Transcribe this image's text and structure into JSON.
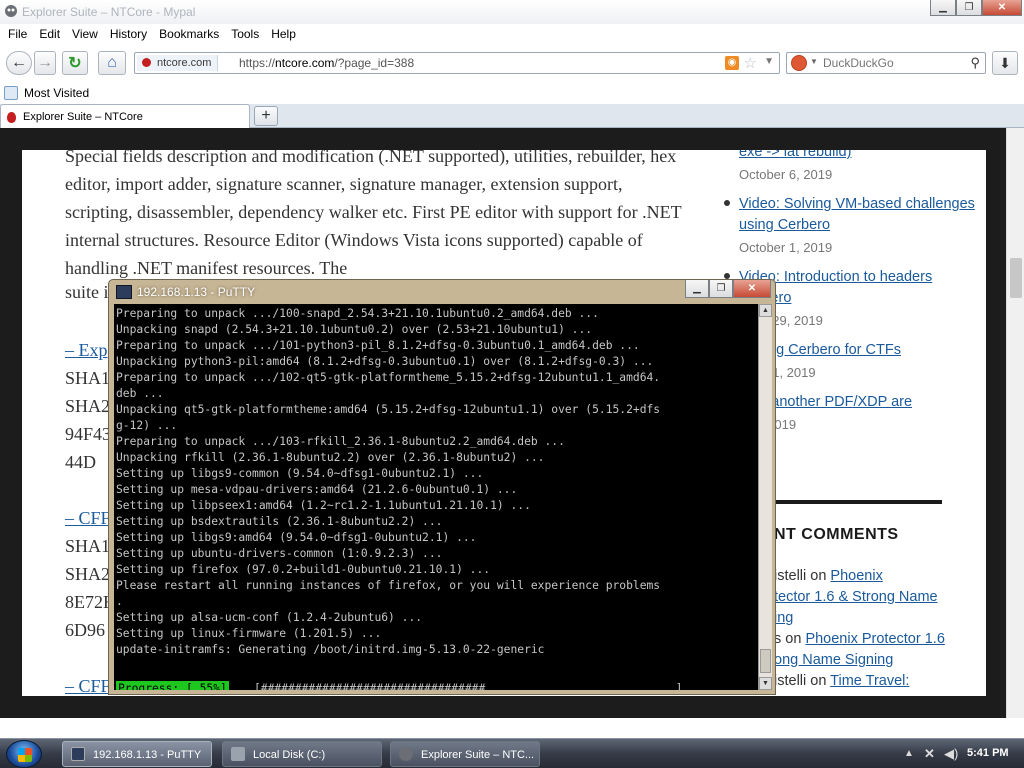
{
  "browser": {
    "title": "Explorer Suite – NTCore - Mypal",
    "menu": [
      "File",
      "Edit",
      "View",
      "History",
      "Bookmarks",
      "Tools",
      "Help"
    ],
    "site_chip": "ntcore.com",
    "url_prefix": "https://",
    "url_host": "ntcore.com",
    "url_path": "/?page_id=388",
    "search_engine": "DuckDuckGo",
    "search_placeholder": "DuckDuckGo",
    "bookmark": "Most Visited",
    "tab_title": "Explorer Suite – NTCore",
    "new_tab": "+"
  },
  "article": {
    "text": "Special fields description and modification (.NET supported), utilities, rebuilder, hex editor, import adder, signature scanner, signature manager, extension support, scripting, disassembler, dependency walker etc. First PE editor with support for .NET internal structures. Resource Editor (Windows Vista icons supported) capable of handling .NET manifest resources. The",
    "suite": "suite i",
    "exp_link": "– Exp",
    "sha1_a": "SHA1:",
    "sha2_a": "SHA2",
    "hash_a": "94F43",
    "hash_b": "44D",
    "cff_link_a": "– CFF",
    "sha1_b": "SHA1:",
    "sha2_b": "SHA2",
    "hash_c": "8E72E",
    "hash_d": "6D96",
    "cff_link_b": "– CFF"
  },
  "sidebar": {
    "posts": [
      {
        "title": "exe -> lat rebuild)",
        "date": "October 6, 2019"
      },
      {
        "title": "Video: Solving VM-based challenges using Cerbero",
        "date": "October 1, 2019"
      },
      {
        "title": "Video: Introduction to headers Cerbero",
        "date": "mber 29, 2019"
      },
      {
        "title": ": Using Cerbero for CTFs",
        "date": "mber 1, 2019"
      },
      {
        "title": ": Yet another PDF/XDP are",
        "date": "st 5, 2019"
      }
    ],
    "recent_heading": "NT COMMENTS",
    "comments": [
      {
        "author": "istelli",
        "on": " on ",
        "link": "Phoenix"
      },
      {
        "author": "",
        "on": "",
        "link": "tector 1.6 & Strong Name"
      },
      {
        "author": "",
        "on": "",
        "link": "ing"
      },
      {
        "author": "s",
        "on": " on ",
        "link": "Phoenix Protector 1.6"
      },
      {
        "author": "",
        "on": "",
        "link": "ong Name Signing"
      },
      {
        "author": "istelli",
        "on": " on ",
        "link": "Time Travel:"
      }
    ]
  },
  "putty": {
    "title": "192.168.1.13 - PuTTY",
    "lines": [
      "Preparing to unpack .../100-snapd_2.54.3+21.10.1ubuntu0.2_amd64.deb ...",
      "Unpacking snapd (2.54.3+21.10.1ubuntu0.2) over (2.53+21.10ubuntu1) ...",
      "Preparing to unpack .../101-python3-pil_8.1.2+dfsg-0.3ubuntu0.1_amd64.deb ...",
      "Unpacking python3-pil:amd64 (8.1.2+dfsg-0.3ubuntu0.1) over (8.1.2+dfsg-0.3) ...",
      "Preparing to unpack .../102-qt5-gtk-platformtheme_5.15.2+dfsg-12ubuntu1.1_amd64.",
      "deb ...",
      "Unpacking qt5-gtk-platformtheme:amd64 (5.15.2+dfsg-12ubuntu1.1) over (5.15.2+dfs",
      "g-12) ...",
      "Preparing to unpack .../103-rfkill_2.36.1-8ubuntu2.2_amd64.deb ...",
      "Unpacking rfkill (2.36.1-8ubuntu2.2) over (2.36.1-8ubuntu2) ...",
      "Setting up libgs9-common (9.54.0~dfsg1-0ubuntu2.1) ...",
      "Setting up mesa-vdpau-drivers:amd64 (21.2.6-0ubuntu0.1) ...",
      "Setting up libpseex1:amd64 (1.2~rc1.2-1.1ubuntu1.21.10.1) ...",
      "Setting up bsdextrautils (2.36.1-8ubuntu2.2) ...",
      "Setting up libgs9:amd64 (9.54.0~dfsg1-0ubuntu2.1) ...",
      "Setting up ubuntu-drivers-common (1:0.9.2.3) ...",
      "Setting up firefox (97.0.2+build1-0ubuntu0.21.10.1) ...",
      "Please restart all running instances of firefox, or you will experience problems",
      ".",
      "Setting up alsa-ucm-conf (1.2.4-2ubuntu6) ...",
      "Setting up linux-firmware (1.201.5) ...",
      "update-initramfs: Generating /boot/initrd.img-5.13.0-22-generic"
    ],
    "progress_label": "Progress: [ 55%]",
    "progress_bar": "[#################################............................]",
    "progress": 0.55
  },
  "taskbar": {
    "tasks": [
      "192.168.1.13 - PuTTY",
      "Local Disk (C:)",
      "Explorer Suite – NTC..."
    ],
    "clock": "5:41 PM"
  }
}
